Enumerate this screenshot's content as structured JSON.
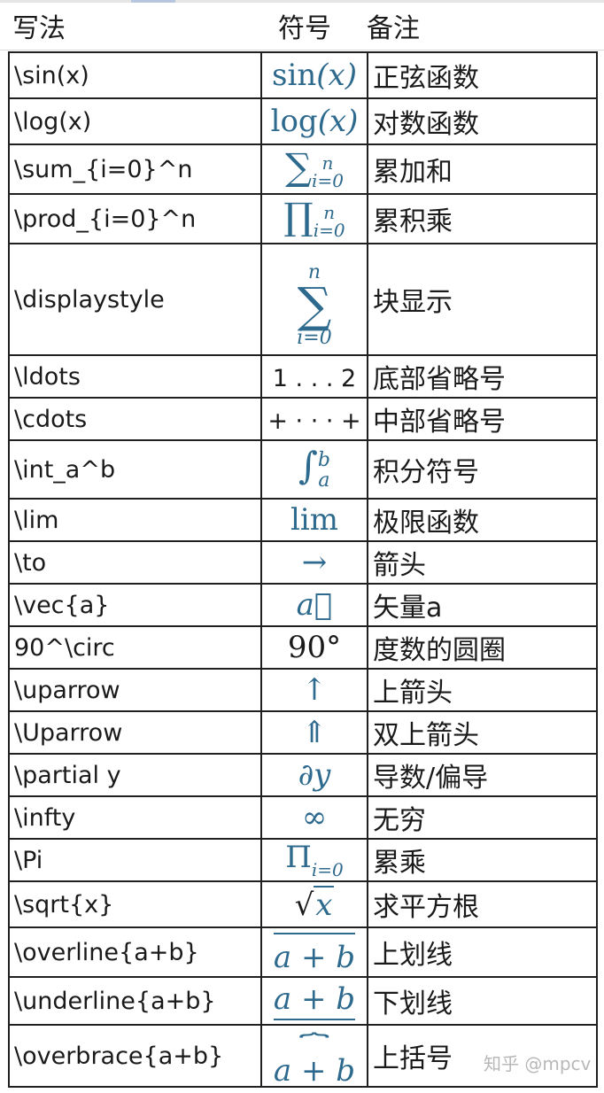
{
  "header": {
    "col_code": "写法",
    "col_symbol": "符号",
    "col_note": "备注"
  },
  "rows": [
    {
      "code": "\\sin(x)",
      "note": "正弦函数"
    },
    {
      "code": "\\log(x)",
      "note": "对数函数"
    },
    {
      "code": "\\sum_{i=0}^n",
      "note": "累加和"
    },
    {
      "code": "\\prod_{i=0}^n",
      "note": "累积乘"
    },
    {
      "code": "\\displaystyle",
      "note": "块显示"
    },
    {
      "code": "\\ldots",
      "note": "底部省略号"
    },
    {
      "code": "\\cdots",
      "note": "中部省略号"
    },
    {
      "code": "\\int_a^b",
      "note": "积分符号"
    },
    {
      "code": "\\lim",
      "note": "极限函数"
    },
    {
      "code": "\\to",
      "note": "箭头"
    },
    {
      "code": "\\vec{a}",
      "note": "矢量a"
    },
    {
      "code": "90^\\circ",
      "note": "度数的圆圈"
    },
    {
      "code": "\\uparrow",
      "note": "上箭头"
    },
    {
      "code": "\\Uparrow",
      "note": "双上箭头"
    },
    {
      "code": "\\partial y",
      "note": "导数/偏导"
    },
    {
      "code": "\\infty",
      "note": "无穷"
    },
    {
      "code": "\\Pi",
      "note": "累乘"
    },
    {
      "code": "\\sqrt{x}",
      "note": "求平方根"
    },
    {
      "code": "\\overline{a+b}",
      "note": "上划线"
    },
    {
      "code": "\\underline{a+b}",
      "note": "下划线"
    },
    {
      "code": "\\overbrace{a+b}",
      "note": "上括号"
    }
  ],
  "symbols": {
    "sin_fn": "sin",
    "sin_arg": "(x)",
    "log_fn": "log",
    "log_arg": "(x)",
    "sum_op": "∑",
    "sum_sup": "n",
    "sum_sub": "i=0",
    "prod_op": "∏",
    "prod_sup": "n",
    "prod_sub": "i=0",
    "disp_sup": "n",
    "disp_op": "∑",
    "disp_sub": "i=0",
    "ldots": "1 . . . 2",
    "cdots": "+ · · · +",
    "int_op": "∫",
    "int_sup": "b",
    "int_sub": "a",
    "lim": "lim",
    "to": "→",
    "vec": "a⃗",
    "deg": "90°",
    "uparrow": "↑",
    "Uparrow": "⇑",
    "partial": "∂y",
    "infty": "∞",
    "pi_op": "Π",
    "pi_sub": "i=0",
    "sqrt_sign": "√",
    "sqrt_arg": "x",
    "overline": "a + b",
    "underline": "a + b",
    "overbrace_brace": "⏞",
    "overbrace": "a + b"
  },
  "watermark": "知乎 @mpcv",
  "colors": {
    "math_blue": "#2e6a8e",
    "text": "#1a1a1a",
    "border": "#202020"
  }
}
